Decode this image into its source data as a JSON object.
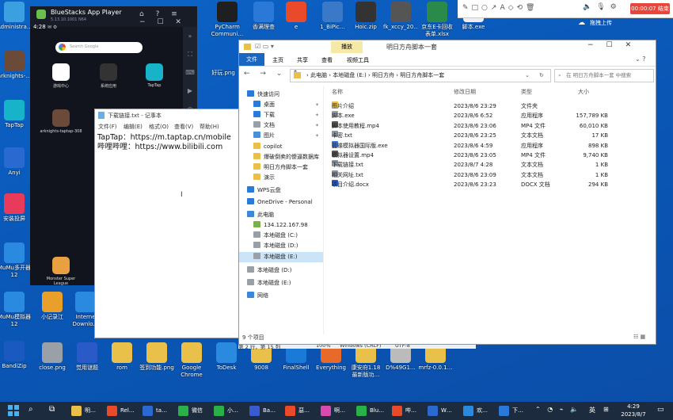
{
  "desktop": {
    "left_icons": [
      {
        "label": "Administra…",
        "color": "#3aa0e0"
      },
      {
        "label": "arknights-…",
        "color": "#6b4a3a"
      },
      {
        "label": "TapTap",
        "color": "#17b3c9"
      },
      {
        "label": "Anyi",
        "color": "#2a6ad0"
      },
      {
        "label": "安装投屏",
        "color": "#e83a5a"
      },
      {
        "label": "MuMu多开器12",
        "color": "#2a8ae0"
      },
      {
        "label": "MuMu模拟器12",
        "color": "#2a8ae0"
      },
      {
        "label": "BandiZip",
        "color": "#1a5ac0"
      }
    ],
    "top_icons": [
      {
        "label": "PyCharm Communi…",
        "color": "#1f1f1f"
      },
      {
        "label": "香满理查",
        "color": "#2a78d8"
      },
      {
        "label": "e",
        "color": "#e84a2a"
      },
      {
        "label": "1_BiPic…",
        "color": "#3a78c8"
      },
      {
        "label": "Hoic.zip",
        "color": "#333"
      },
      {
        "label": "fk_xccy_20…",
        "color": "#555"
      },
      {
        "label": "京东E卡回收 表单.xlsx",
        "color": "#2a8a4a"
      },
      {
        "label": "脚本.exe",
        "color": "#eee"
      }
    ],
    "bottom_icons": [
      {
        "label": "小记录江",
        "color": "#e8a02a"
      },
      {
        "label": "Interne Downlo…",
        "color": "#2a8ae0"
      },
      {
        "label": "close.png",
        "color": "#9aa0a8"
      },
      {
        "label": "觉用谜题",
        "color": "#2a5ac8"
      },
      {
        "label": "rom",
        "color": "#e8c04a"
      },
      {
        "label": "签到功能.png",
        "color": "#e8c04a"
      },
      {
        "label": "Google Chrome",
        "color": "#e8c04a"
      },
      {
        "label": "ToDesk",
        "color": "#2a8ae0"
      },
      {
        "label": "9008",
        "color": "#e8c04a"
      },
      {
        "label": "FinalShell",
        "color": "#1a7ad8"
      },
      {
        "label": "Everything",
        "color": "#e86a2a"
      },
      {
        "label": "康安府1.18 最新版功…",
        "color": "#e8c04a"
      },
      {
        "label": "D%49G1…",
        "color": "#bbb"
      },
      {
        "label": "mrfz-0.0.1…",
        "color": "#e8c04a"
      }
    ],
    "right_label": "好玩.png"
  },
  "recorder": {
    "timer": "00:00:07",
    "stop_label": "结束",
    "upload_label": "拖拽上传"
  },
  "bluestacks": {
    "title": "BlueStacks App Player",
    "version": "5.13.10.1001 N64",
    "time": "4:28",
    "search_placeholder": "Search Google",
    "apps": [
      {
        "label": "游戏中心",
        "color": "#fff"
      },
      {
        "label": "系统应用",
        "color": "#333"
      },
      {
        "label": "TapTap",
        "color": "#17b3c9"
      },
      {
        "label": "arknights-taptap-308",
        "color": "#6b4a3a"
      },
      {
        "label": "Monster Super League",
        "color": "#e8a040"
      }
    ]
  },
  "notepad": {
    "title": "下载链接.txt - 记事本",
    "menu": [
      "文件(F)",
      "编辑(E)",
      "格式(O)",
      "查看(V)",
      "帮助(H)"
    ],
    "lines": [
      "TapTap：https://m.taptap.cn/mobile",
      "哔哩哔哩：https://www.bilibili.com"
    ],
    "status": {
      "pos": "第 2 行，第 15 列",
      "zoom": "100%",
      "eol": "Windows (CRLF)",
      "enc": "UTF-8"
    }
  },
  "explorer": {
    "title": "明日方舟脚本一套",
    "ribbon_context": "播放",
    "ribbon_tabs": [
      "文件",
      "主页",
      "共享",
      "查看",
      "视频工具"
    ],
    "breadcrumb": [
      "此电脑",
      "本地磁盘 (E:)",
      "明日方舟",
      "明日方舟脚本一套"
    ],
    "search_placeholder": "在 明日方舟脚本一套 中搜索",
    "columns": [
      "名称",
      "修改日期",
      "类型",
      "大小"
    ],
    "files": [
      {
        "name": "图片介绍",
        "date": "2023/8/6 23:29",
        "type": "文件夹",
        "size": "",
        "color": "#e8c04a"
      },
      {
        "name": "脚本.exe",
        "date": "2023/8/6 6:52",
        "type": "应用程序",
        "size": "157,789 KB",
        "color": "#9aa0a8"
      },
      {
        "name": "脚本使用教程.mp4",
        "date": "2023/8/6 23:06",
        "type": "MP4 文件",
        "size": "60,010 KB",
        "color": "#555"
      },
      {
        "name": "卡密.txt",
        "date": "2023/8/6 23:25",
        "type": "文本文档",
        "size": "17 KB",
        "color": "#8a94a0"
      },
      {
        "name": "蓝蝶模拟器国际版.exe",
        "date": "2023/8/6 4:59",
        "type": "应用程序",
        "size": "898 KB",
        "color": "#3a78d8"
      },
      {
        "name": "模拟器设置.mp4",
        "date": "2023/8/6 23:05",
        "type": "MP4 文件",
        "size": "9,740 KB",
        "color": "#555"
      },
      {
        "name": "下载链接.txt",
        "date": "2023/8/7 4:28",
        "type": "文本文档",
        "size": "1 KB",
        "color": "#8a94a0"
      },
      {
        "name": "相关网址.txt",
        "date": "2023/8/6 23:09",
        "type": "文本文档",
        "size": "1 KB",
        "color": "#8a94a0"
      },
      {
        "name": "项目介绍.docx",
        "date": "2023/8/6 23:23",
        "type": "DOCX 文档",
        "size": "294 KB",
        "color": "#2a5ac8"
      }
    ],
    "nav": [
      {
        "label": "快速访问",
        "color": "#2a7ad8",
        "indent": 0,
        "pin": false
      },
      {
        "label": "桌面",
        "color": "#2a7ad8",
        "indent": 1,
        "pin": true
      },
      {
        "label": "下载",
        "color": "#2a7ad8",
        "indent": 1,
        "pin": true
      },
      {
        "label": "文档",
        "color": "#9aa0a8",
        "indent": 1,
        "pin": true
      },
      {
        "label": "图片",
        "color": "#4a90d8",
        "indent": 1,
        "pin": true
      },
      {
        "label": "copilot",
        "color": "#e8c04a",
        "indent": 1,
        "pin": false
      },
      {
        "label": "爆破倒卖的傻逼数据库",
        "color": "#e8c04a",
        "indent": 1,
        "pin": false
      },
      {
        "label": "明日方舟脚本一套",
        "color": "#e8c04a",
        "indent": 1,
        "pin": false
      },
      {
        "label": "演示",
        "color": "#e8c04a",
        "indent": 1,
        "pin": false
      },
      {
        "label": "WPS云盘",
        "color": "#2a7ad8",
        "indent": 0,
        "pin": false
      },
      {
        "label": "OneDrive - Personal",
        "color": "#2a7ad8",
        "indent": 0,
        "pin": false
      },
      {
        "label": "此电脑",
        "color": "#3a88d8",
        "indent": 0,
        "pin": false
      },
      {
        "label": "134.122.167.98",
        "color": "#7ab04a",
        "indent": 1,
        "pin": false
      },
      {
        "label": "本地磁盘 (C:)",
        "color": "#9aa0a8",
        "indent": 1,
        "pin": false
      },
      {
        "label": "本地磁盘 (D:)",
        "color": "#9aa0a8",
        "indent": 1,
        "pin": false
      },
      {
        "label": "本地磁盘 (E:)",
        "color": "#9aa0a8",
        "indent": 1,
        "pin": false
      },
      {
        "label": "本地磁盘 (D:)",
        "color": "#9aa0a8",
        "indent": 0,
        "pin": false
      },
      {
        "label": "本地磁盘 (E:)",
        "color": "#9aa0a8",
        "indent": 0,
        "pin": false
      },
      {
        "label": "网络",
        "color": "#3a88d8",
        "indent": 0,
        "pin": false
      }
    ],
    "selected_nav": 15,
    "status": "9 个项目"
  },
  "taskbar": {
    "items": [
      {
        "label": "明…",
        "color": "#e8c04a"
      },
      {
        "label": "Rel…",
        "color": "#e84a2a"
      },
      {
        "label": "ta…",
        "color": "#2a6ad0"
      },
      {
        "label": "微信",
        "color": "#2ab04a"
      },
      {
        "label": "小…",
        "color": "#2ab04a"
      },
      {
        "label": "Ba…",
        "color": "#3a5ad0"
      },
      {
        "label": "惡…",
        "color": "#e84a2a"
      },
      {
        "label": "啊…",
        "color": "#d84ab0"
      },
      {
        "label": "Blu…",
        "color": "#2ab04a"
      },
      {
        "label": "哔…",
        "color": "#e84a2a"
      },
      {
        "label": "W…",
        "color": "#2a6ad0"
      },
      {
        "label": "欢…",
        "color": "#2a8ae0"
      },
      {
        "label": "下…",
        "color": "#2a78d8"
      }
    ],
    "time": "4:29",
    "date": "2023/8/7",
    "lang": "英"
  }
}
